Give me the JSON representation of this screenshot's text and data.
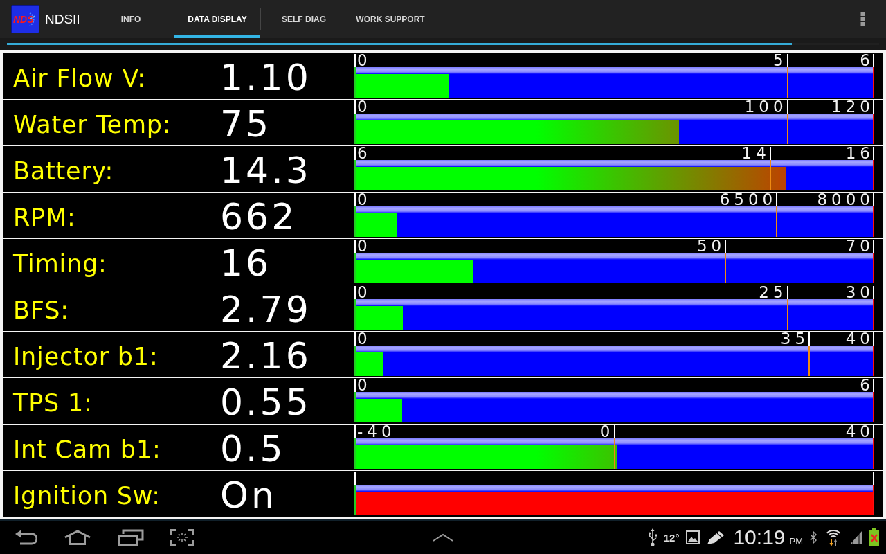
{
  "app_bar": {
    "logo_text": "NDS",
    "title": "NDSII",
    "tabs": [
      {
        "label": "INFO",
        "selected": false
      },
      {
        "label": "DATA DISPLAY",
        "selected": true
      },
      {
        "label": "SELF DIAG",
        "selected": false
      },
      {
        "label": "WORK SUPPORT",
        "selected": false
      }
    ]
  },
  "progress": {
    "level": 0.9
  },
  "readings": [
    {
      "kind": "bar",
      "label": "Air Flow V:",
      "value": "1.10",
      "scale_min": "0",
      "threshold": {
        "label": "5",
        "level": 0.833
      },
      "scale_max": "6",
      "level": 0.183
    },
    {
      "kind": "bar",
      "label": "Water Temp:",
      "value": "75",
      "scale_min": "0",
      "threshold": {
        "label": "100",
        "level": 0.833
      },
      "scale_max": "120",
      "level": 0.625
    },
    {
      "kind": "bar",
      "label": "Battery:",
      "value": "14.3",
      "scale_min": "6",
      "threshold": {
        "label": "14",
        "level": 0.8
      },
      "scale_max": "16",
      "level": 0.83
    },
    {
      "kind": "bar",
      "label": "RPM:",
      "value": "662",
      "scale_min": "0",
      "threshold": {
        "label": "6500",
        "level": 0.8125
      },
      "scale_max": "8000",
      "level": 0.083
    },
    {
      "kind": "bar",
      "label": "Timing:",
      "value": "16",
      "scale_min": "0",
      "threshold": {
        "label": "50",
        "level": 0.714
      },
      "scale_max": "70",
      "level": 0.229
    },
    {
      "kind": "bar",
      "label": "BFS:",
      "value": "2.79",
      "scale_min": "0",
      "threshold": {
        "label": "25",
        "level": 0.833
      },
      "scale_max": "30",
      "level": 0.093
    },
    {
      "kind": "bar",
      "label": "Injector b1:",
      "value": "2.16",
      "scale_min": "0",
      "threshold": {
        "label": "35",
        "level": 0.875
      },
      "scale_max": "40",
      "level": 0.054
    },
    {
      "kind": "bar",
      "label": "TPS 1:",
      "value": "0.55",
      "scale_min": "0",
      "scale_max": "6",
      "level": 0.092
    },
    {
      "kind": "bar",
      "label": "Int Cam b1:",
      "value": "0.5",
      "scale_min": "-40",
      "threshold": {
        "label": "0",
        "level": 0.5
      },
      "scale_max": "40",
      "level": 0.506
    },
    {
      "kind": "switch",
      "label": "Ignition Sw:",
      "value": "On",
      "on": true
    }
  ],
  "status_bar": {
    "temperature": "12°",
    "time": "10:19",
    "meridiem": "PM"
  }
}
